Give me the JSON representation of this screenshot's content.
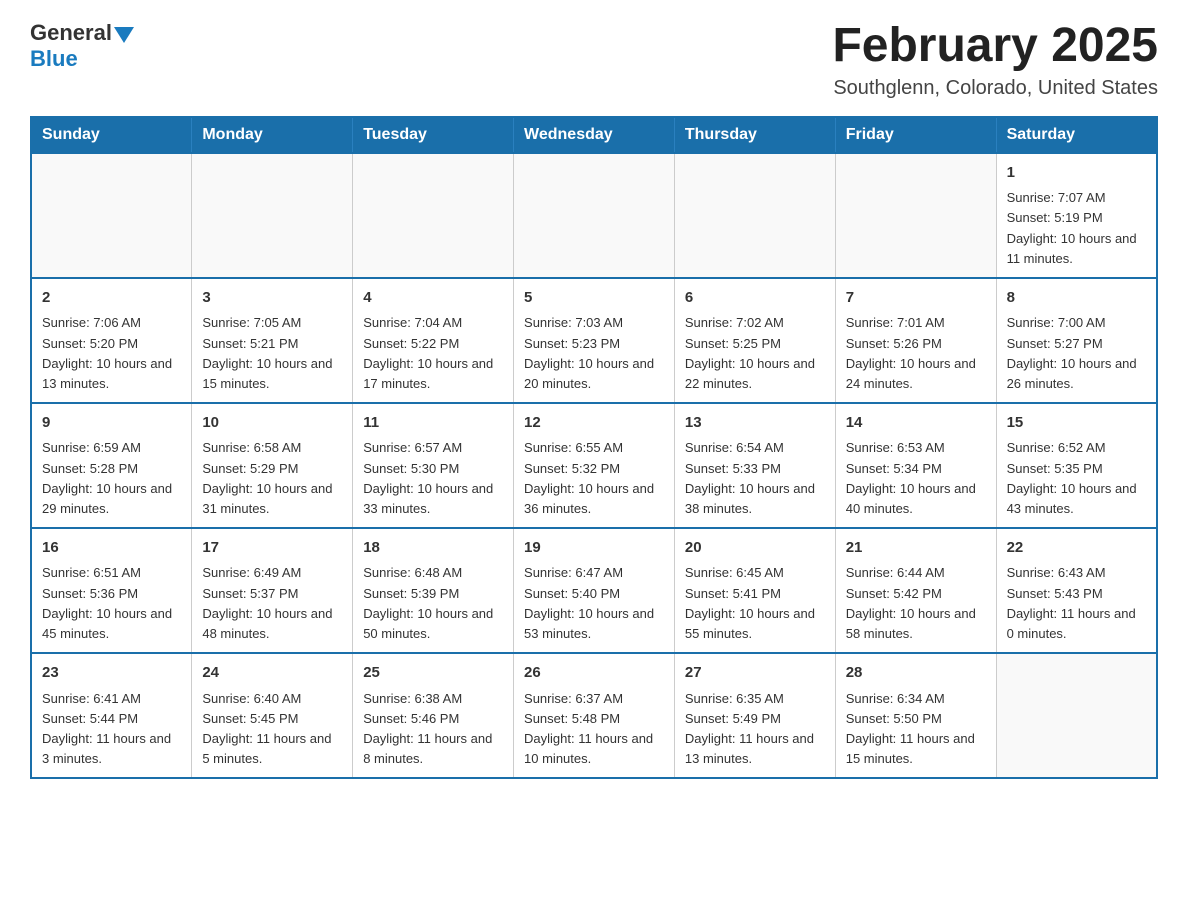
{
  "header": {
    "logo_general": "General",
    "logo_blue": "Blue",
    "month": "February 2025",
    "location": "Southglenn, Colorado, United States"
  },
  "weekdays": [
    "Sunday",
    "Monday",
    "Tuesday",
    "Wednesday",
    "Thursday",
    "Friday",
    "Saturday"
  ],
  "weeks": [
    [
      {
        "day": "",
        "info": ""
      },
      {
        "day": "",
        "info": ""
      },
      {
        "day": "",
        "info": ""
      },
      {
        "day": "",
        "info": ""
      },
      {
        "day": "",
        "info": ""
      },
      {
        "day": "",
        "info": ""
      },
      {
        "day": "1",
        "info": "Sunrise: 7:07 AM\nSunset: 5:19 PM\nDaylight: 10 hours and 11 minutes."
      }
    ],
    [
      {
        "day": "2",
        "info": "Sunrise: 7:06 AM\nSunset: 5:20 PM\nDaylight: 10 hours and 13 minutes."
      },
      {
        "day": "3",
        "info": "Sunrise: 7:05 AM\nSunset: 5:21 PM\nDaylight: 10 hours and 15 minutes."
      },
      {
        "day": "4",
        "info": "Sunrise: 7:04 AM\nSunset: 5:22 PM\nDaylight: 10 hours and 17 minutes."
      },
      {
        "day": "5",
        "info": "Sunrise: 7:03 AM\nSunset: 5:23 PM\nDaylight: 10 hours and 20 minutes."
      },
      {
        "day": "6",
        "info": "Sunrise: 7:02 AM\nSunset: 5:25 PM\nDaylight: 10 hours and 22 minutes."
      },
      {
        "day": "7",
        "info": "Sunrise: 7:01 AM\nSunset: 5:26 PM\nDaylight: 10 hours and 24 minutes."
      },
      {
        "day": "8",
        "info": "Sunrise: 7:00 AM\nSunset: 5:27 PM\nDaylight: 10 hours and 26 minutes."
      }
    ],
    [
      {
        "day": "9",
        "info": "Sunrise: 6:59 AM\nSunset: 5:28 PM\nDaylight: 10 hours and 29 minutes."
      },
      {
        "day": "10",
        "info": "Sunrise: 6:58 AM\nSunset: 5:29 PM\nDaylight: 10 hours and 31 minutes."
      },
      {
        "day": "11",
        "info": "Sunrise: 6:57 AM\nSunset: 5:30 PM\nDaylight: 10 hours and 33 minutes."
      },
      {
        "day": "12",
        "info": "Sunrise: 6:55 AM\nSunset: 5:32 PM\nDaylight: 10 hours and 36 minutes."
      },
      {
        "day": "13",
        "info": "Sunrise: 6:54 AM\nSunset: 5:33 PM\nDaylight: 10 hours and 38 minutes."
      },
      {
        "day": "14",
        "info": "Sunrise: 6:53 AM\nSunset: 5:34 PM\nDaylight: 10 hours and 40 minutes."
      },
      {
        "day": "15",
        "info": "Sunrise: 6:52 AM\nSunset: 5:35 PM\nDaylight: 10 hours and 43 minutes."
      }
    ],
    [
      {
        "day": "16",
        "info": "Sunrise: 6:51 AM\nSunset: 5:36 PM\nDaylight: 10 hours and 45 minutes."
      },
      {
        "day": "17",
        "info": "Sunrise: 6:49 AM\nSunset: 5:37 PM\nDaylight: 10 hours and 48 minutes."
      },
      {
        "day": "18",
        "info": "Sunrise: 6:48 AM\nSunset: 5:39 PM\nDaylight: 10 hours and 50 minutes."
      },
      {
        "day": "19",
        "info": "Sunrise: 6:47 AM\nSunset: 5:40 PM\nDaylight: 10 hours and 53 minutes."
      },
      {
        "day": "20",
        "info": "Sunrise: 6:45 AM\nSunset: 5:41 PM\nDaylight: 10 hours and 55 minutes."
      },
      {
        "day": "21",
        "info": "Sunrise: 6:44 AM\nSunset: 5:42 PM\nDaylight: 10 hours and 58 minutes."
      },
      {
        "day": "22",
        "info": "Sunrise: 6:43 AM\nSunset: 5:43 PM\nDaylight: 11 hours and 0 minutes."
      }
    ],
    [
      {
        "day": "23",
        "info": "Sunrise: 6:41 AM\nSunset: 5:44 PM\nDaylight: 11 hours and 3 minutes."
      },
      {
        "day": "24",
        "info": "Sunrise: 6:40 AM\nSunset: 5:45 PM\nDaylight: 11 hours and 5 minutes."
      },
      {
        "day": "25",
        "info": "Sunrise: 6:38 AM\nSunset: 5:46 PM\nDaylight: 11 hours and 8 minutes."
      },
      {
        "day": "26",
        "info": "Sunrise: 6:37 AM\nSunset: 5:48 PM\nDaylight: 11 hours and 10 minutes."
      },
      {
        "day": "27",
        "info": "Sunrise: 6:35 AM\nSunset: 5:49 PM\nDaylight: 11 hours and 13 minutes."
      },
      {
        "day": "28",
        "info": "Sunrise: 6:34 AM\nSunset: 5:50 PM\nDaylight: 11 hours and 15 minutes."
      },
      {
        "day": "",
        "info": ""
      }
    ]
  ]
}
